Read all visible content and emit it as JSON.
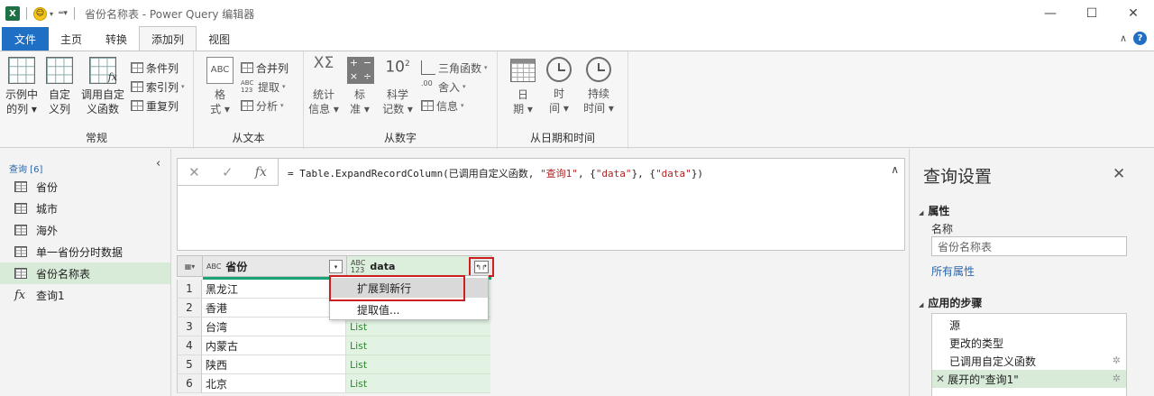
{
  "window": {
    "title": "省份名称表 - Power Query 编辑器",
    "app_icon": "X",
    "minimize": "—",
    "maximize": "☐",
    "close": "✕"
  },
  "tabs": [
    {
      "label": "文件"
    },
    {
      "label": "主页"
    },
    {
      "label": "转换"
    },
    {
      "label": "添加列"
    },
    {
      "label": "视图"
    }
  ],
  "ribbon": {
    "general": {
      "group_label": "常规",
      "example_col": [
        "示例中",
        "的列 ▾"
      ],
      "custom_col": [
        "自定",
        "义列"
      ],
      "invoke_fn": [
        "调用自定",
        "义函数"
      ],
      "conditional": "条件列",
      "index": "索引列",
      "duplicate": "重复列"
    },
    "from_text": {
      "group_label": "从文本",
      "format": [
        "格",
        "式 ▾"
      ],
      "merge": "合并列",
      "extract": "提取",
      "parse": "分析"
    },
    "from_number": {
      "group_label": "从数字",
      "stats": [
        "统计",
        "信息 ▾"
      ],
      "standard": [
        "标",
        "准 ▾"
      ],
      "scientific": [
        "科学",
        "记数 ▾"
      ],
      "trig": "三角函数",
      "rounding": "舍入",
      "info": "信息"
    },
    "from_datetime": {
      "group_label": "从日期和时间",
      "date": [
        "日",
        "期 ▾"
      ],
      "time": [
        "时",
        "间 ▾"
      ],
      "duration": [
        "持续",
        "时间 ▾"
      ]
    }
  },
  "queries": {
    "header": "查询 [6]",
    "items": [
      {
        "label": "省份",
        "icon": "table-icon"
      },
      {
        "label": "城市",
        "icon": "table-icon"
      },
      {
        "label": "海外",
        "icon": "table-icon"
      },
      {
        "label": "单一省份分时数据",
        "icon": "table-icon"
      },
      {
        "label": "省份名称表",
        "icon": "table-icon"
      },
      {
        "label": "查询1",
        "icon": "function-icon"
      }
    ],
    "selected_index": 4
  },
  "formula": {
    "prefix": "= Table.ExpandRecordColumn(已调用自定义函数, ",
    "arg1": "\"查询1\"",
    "mid1": ", {",
    "arg2": "\"data\"",
    "mid2": "}, {",
    "arg3": "\"data\"",
    "suffix": "})"
  },
  "grid": {
    "col1_header": "省份",
    "col2_header": "data",
    "col1_type": "ABC",
    "col2_type": [
      "ABC",
      "123"
    ],
    "rows": [
      {
        "n": "1",
        "province": "黑龙江",
        "data": ""
      },
      {
        "n": "2",
        "province": "香港",
        "data": ""
      },
      {
        "n": "3",
        "province": "台湾",
        "data": "List"
      },
      {
        "n": "4",
        "province": "内蒙古",
        "data": "List"
      },
      {
        "n": "5",
        "province": "陕西",
        "data": "List"
      },
      {
        "n": "6",
        "province": "北京",
        "data": "List"
      }
    ]
  },
  "context_menu": {
    "items": [
      "扩展到新行",
      "提取值..."
    ]
  },
  "settings": {
    "title": "查询设置",
    "properties_head": "属性",
    "name_label": "名称",
    "name_value": "省份名称表",
    "all_properties": "所有属性",
    "steps_head": "应用的步骤",
    "steps": [
      {
        "label": "源"
      },
      {
        "label": "更改的类型"
      },
      {
        "label": "已调用自定义函数"
      },
      {
        "label": "展开的\"查询1\""
      }
    ]
  },
  "colors": {
    "file_tab": "#1f6fc5",
    "selection_green": "#d8ebd8",
    "highlight_red": "#cc1f1f",
    "quality_bar": "#1aa376"
  }
}
